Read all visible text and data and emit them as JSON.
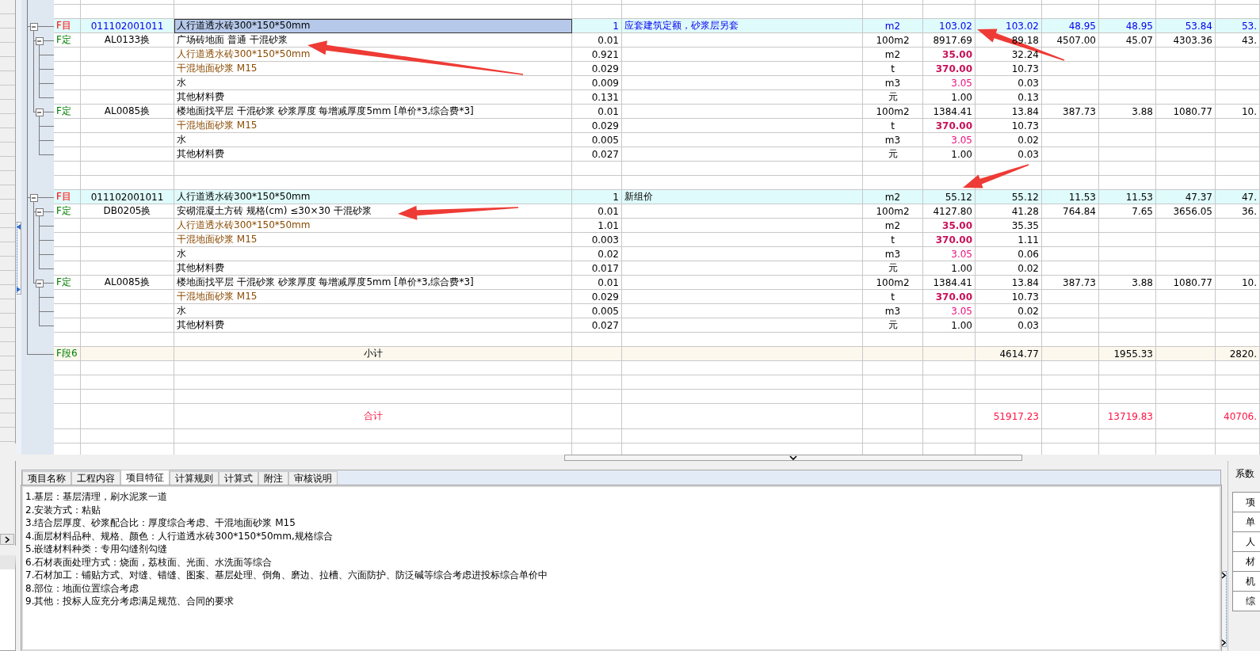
{
  "table": {
    "rows": [
      {
        "kind": "blank"
      },
      {
        "kind": "blank"
      },
      {
        "kind": "item",
        "type": "F目",
        "code": "011102001011",
        "name": "人行道透水砖300*150*50mm",
        "qty": "1",
        "remark": "应套建筑定额，砂浆层另套",
        "unit": "m2",
        "price": "103.02",
        "amount": "103.02",
        "column_9": "48.95",
        "column_10": "48.95",
        "column_11": "53.84",
        "column_12": "53.",
        "selected": true,
        "children": [
          {
            "kind": "quota",
            "type": "F定",
            "code": "AL0133换",
            "name": "广场砖地面 普通 干混砂浆",
            "qty": "0.01",
            "unit": "100m2",
            "price": "8917.69",
            "amount": "89.18",
            "column_9": "4507.00",
            "column_10": "45.07",
            "column_11": "4303.36",
            "column_12": "43.",
            "children": [
              {
                "kind": "main_material",
                "name": "人行道透水砖300*150*50mm",
                "qty": "0.921",
                "unit": "m2",
                "price": "35.00",
                "amount": "32.24"
              },
              {
                "kind": "main_material",
                "name": "干混地面砂浆 M15",
                "qty": "0.029",
                "unit": "t",
                "price": "370.00",
                "amount": "10.73"
              },
              {
                "kind": "aux_material",
                "name": "水",
                "qty": "0.009",
                "unit": "m3",
                "price": "3.05",
                "amount": "0.03"
              },
              {
                "kind": "other_material",
                "name": "其他材料费",
                "qty": "0.131",
                "unit": "元",
                "price": "1.00",
                "amount": "0.13"
              }
            ]
          },
          {
            "kind": "quota",
            "type": "F定",
            "code": "AL0085换",
            "name": "楼地面找平层 干混砂浆 砂浆厚度 每增减厚度5mm [单价*3,综合费*3]",
            "qty": "0.01",
            "unit": "100m2",
            "price": "1384.41",
            "amount": "13.84",
            "column_9": "387.73",
            "column_10": "3.88",
            "column_11": "1080.77",
            "column_12": "10.",
            "children": [
              {
                "kind": "main_material",
                "name": "干混地面砂浆 M15",
                "qty": "0.029",
                "unit": "t",
                "price": "370.00",
                "amount": "10.73"
              },
              {
                "kind": "aux_material",
                "name": "水",
                "qty": "0.005",
                "unit": "m3",
                "price": "3.05",
                "amount": "0.02"
              },
              {
                "kind": "other_material",
                "name": "其他材料费",
                "qty": "0.027",
                "unit": "元",
                "price": "1.00",
                "amount": "0.03"
              }
            ]
          }
        ]
      },
      {
        "kind": "blank"
      },
      {
        "kind": "blank"
      },
      {
        "kind": "item",
        "type": "F目",
        "code": "011102001011",
        "name": "人行道透水砖300*150*50mm",
        "qty": "1",
        "remark": "新组价",
        "unit": "m2",
        "price": "55.12",
        "amount": "55.12",
        "column_9": "11.53",
        "column_10": "11.53",
        "column_11": "47.37",
        "column_12": "47.",
        "selected": false,
        "children": [
          {
            "kind": "quota",
            "type": "F定",
            "code": "DB0205换",
            "name": "安砌混凝土方砖 规格(cm) ≤30×30 干混砂浆",
            "qty": "0.01",
            "unit": "100m2",
            "price": "4127.80",
            "amount": "41.28",
            "column_9": "764.84",
            "column_10": "7.65",
            "column_11": "3656.05",
            "column_12": "36.",
            "children": [
              {
                "kind": "main_material",
                "name": "人行道透水砖300*150*50mm",
                "qty": "1.01",
                "unit": "m2",
                "price": "35.00",
                "amount": "35.35"
              },
              {
                "kind": "main_material",
                "name": "干混地面砂浆 M15",
                "qty": "0.003",
                "unit": "t",
                "price": "370.00",
                "amount": "1.11"
              },
              {
                "kind": "aux_material",
                "name": "水",
                "qty": "0.02",
                "unit": "m3",
                "price": "3.05",
                "amount": "0.06"
              },
              {
                "kind": "other_material",
                "name": "其他材料费",
                "qty": "0.017",
                "unit": "元",
                "price": "1.00",
                "amount": "0.02"
              }
            ]
          },
          {
            "kind": "quota",
            "type": "F定",
            "code": "AL0085换",
            "name": "楼地面找平层 干混砂浆 砂浆厚度 每增减厚度5mm [单价*3,综合费*3]",
            "qty": "0.01",
            "unit": "100m2",
            "price": "1384.41",
            "amount": "13.84",
            "column_9": "387.73",
            "column_10": "3.88",
            "column_11": "1080.77",
            "column_12": "10.",
            "children": [
              {
                "kind": "main_material",
                "name": "干混地面砂浆 M15",
                "qty": "0.029",
                "unit": "t",
                "price": "370.00",
                "amount": "10.73"
              },
              {
                "kind": "aux_material",
                "name": "水",
                "qty": "0.005",
                "unit": "m3",
                "price": "3.05",
                "amount": "0.02"
              },
              {
                "kind": "other_material",
                "name": "其他材料费",
                "qty": "0.027",
                "unit": "元",
                "price": "1.00",
                "amount": "0.03"
              }
            ]
          }
        ]
      },
      {
        "kind": "blank"
      },
      {
        "kind": "subtotal",
        "type": "F段6",
        "name": "小计",
        "amount": "4614.77",
        "column_10": "1955.33",
        "column_12": "2820."
      },
      {
        "kind": "blank"
      },
      {
        "kind": "blank"
      },
      {
        "kind": "blank"
      },
      {
        "kind": "total",
        "name": "合计",
        "amount": "51917.23",
        "column_10": "13719.83",
        "column_12": "40706."
      },
      {
        "kind": "blank"
      },
      {
        "kind": "blank"
      }
    ]
  },
  "detail_tabs": [
    {
      "label": "项目名称",
      "selected": false
    },
    {
      "label": "工程内容",
      "selected": false
    },
    {
      "label": "项目特征",
      "selected": true
    },
    {
      "label": "计算规则",
      "selected": false
    },
    {
      "label": "计算式",
      "selected": false
    },
    {
      "label": "附注",
      "selected": false
    },
    {
      "label": "审核说明",
      "selected": false
    }
  ],
  "feature_lines": [
    "1.基层：基层清理，刷水泥浆一道",
    "2.安装方式：粘贴",
    "3.结合层厚度、砂浆配合比：厚度综合考虑、干混地面砂浆 M15",
    "4.面层材料品种、规格、颜色：人行道透水砖300*150*50mm,规格综合",
    "5.嵌缝材料种类：专用勾缝剂勾缝",
    "6.石材表面处理方式：烧面，荔枝面、光面、水洗面等综合",
    "7.石材加工：铺贴方式、对缝、错缝、图案、基层处理、倒角、磨边、拉槽、六面防护、防泛碱等综合考虑进投标综合单价中",
    "8.部位：地面位置综合考虑",
    "9.其他：投标人应充分考虑满足规范、合同的要求"
  ],
  "coefficient_panel": {
    "title": "系数",
    "rows": [
      "项",
      "单",
      "人",
      "材",
      "机",
      "综"
    ]
  }
}
